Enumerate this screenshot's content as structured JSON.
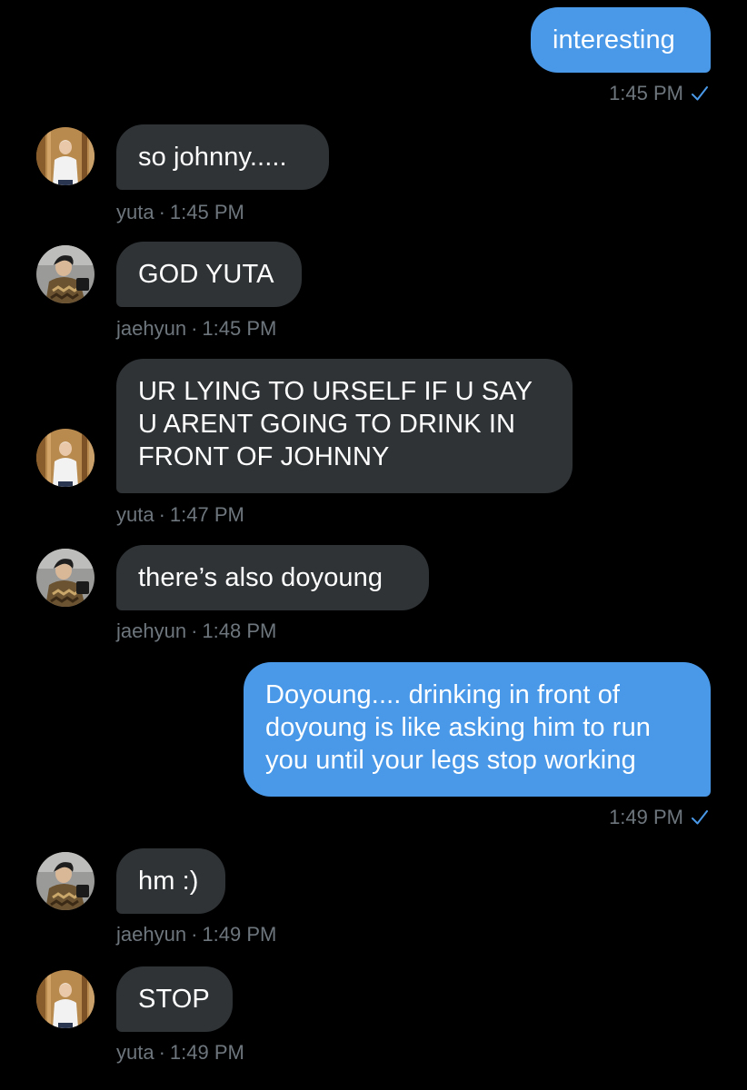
{
  "colors": {
    "background": "#000000",
    "incoming_bubble": "#2f3336",
    "outgoing_bubble": "#4a99e9",
    "meta_text": "#6e767d",
    "read_check": "#4a99e9"
  },
  "messages": [
    {
      "direction": "outgoing",
      "text": "interesting",
      "time": "1:45 PM",
      "read_icon": "checkmark-icon"
    },
    {
      "direction": "incoming",
      "sender": "yuta",
      "text": "so johnny.....",
      "time": "1:45 PM",
      "avatar": "yuta-avatar"
    },
    {
      "direction": "incoming",
      "sender": "jaehyun",
      "text": "GOD YUTA",
      "time": "1:45 PM",
      "avatar": "jaehyun-avatar"
    },
    {
      "direction": "incoming",
      "sender": "yuta",
      "text": "UR LYING TO URSELF IF U SAY\nU ARENT GOING TO DRINK IN\nFRONT OF JOHNNY",
      "time": "1:47 PM",
      "avatar": "yuta-avatar"
    },
    {
      "direction": "incoming",
      "sender": "jaehyun",
      "text": "there’s also doyoung",
      "time": "1:48 PM",
      "avatar": "jaehyun-avatar"
    },
    {
      "direction": "outgoing",
      "text": "Doyoung.... drinking in front of\ndoyoung is like asking him to run\nyou until your legs stop working",
      "time": "1:49 PM",
      "read_icon": "checkmark-icon"
    },
    {
      "direction": "incoming",
      "sender": "jaehyun",
      "text": "hm :)",
      "time": "1:49 PM",
      "avatar": "jaehyun-avatar"
    },
    {
      "direction": "incoming",
      "sender": "yuta",
      "text": "STOP",
      "time": "1:49 PM",
      "avatar": "yuta-avatar"
    }
  ]
}
